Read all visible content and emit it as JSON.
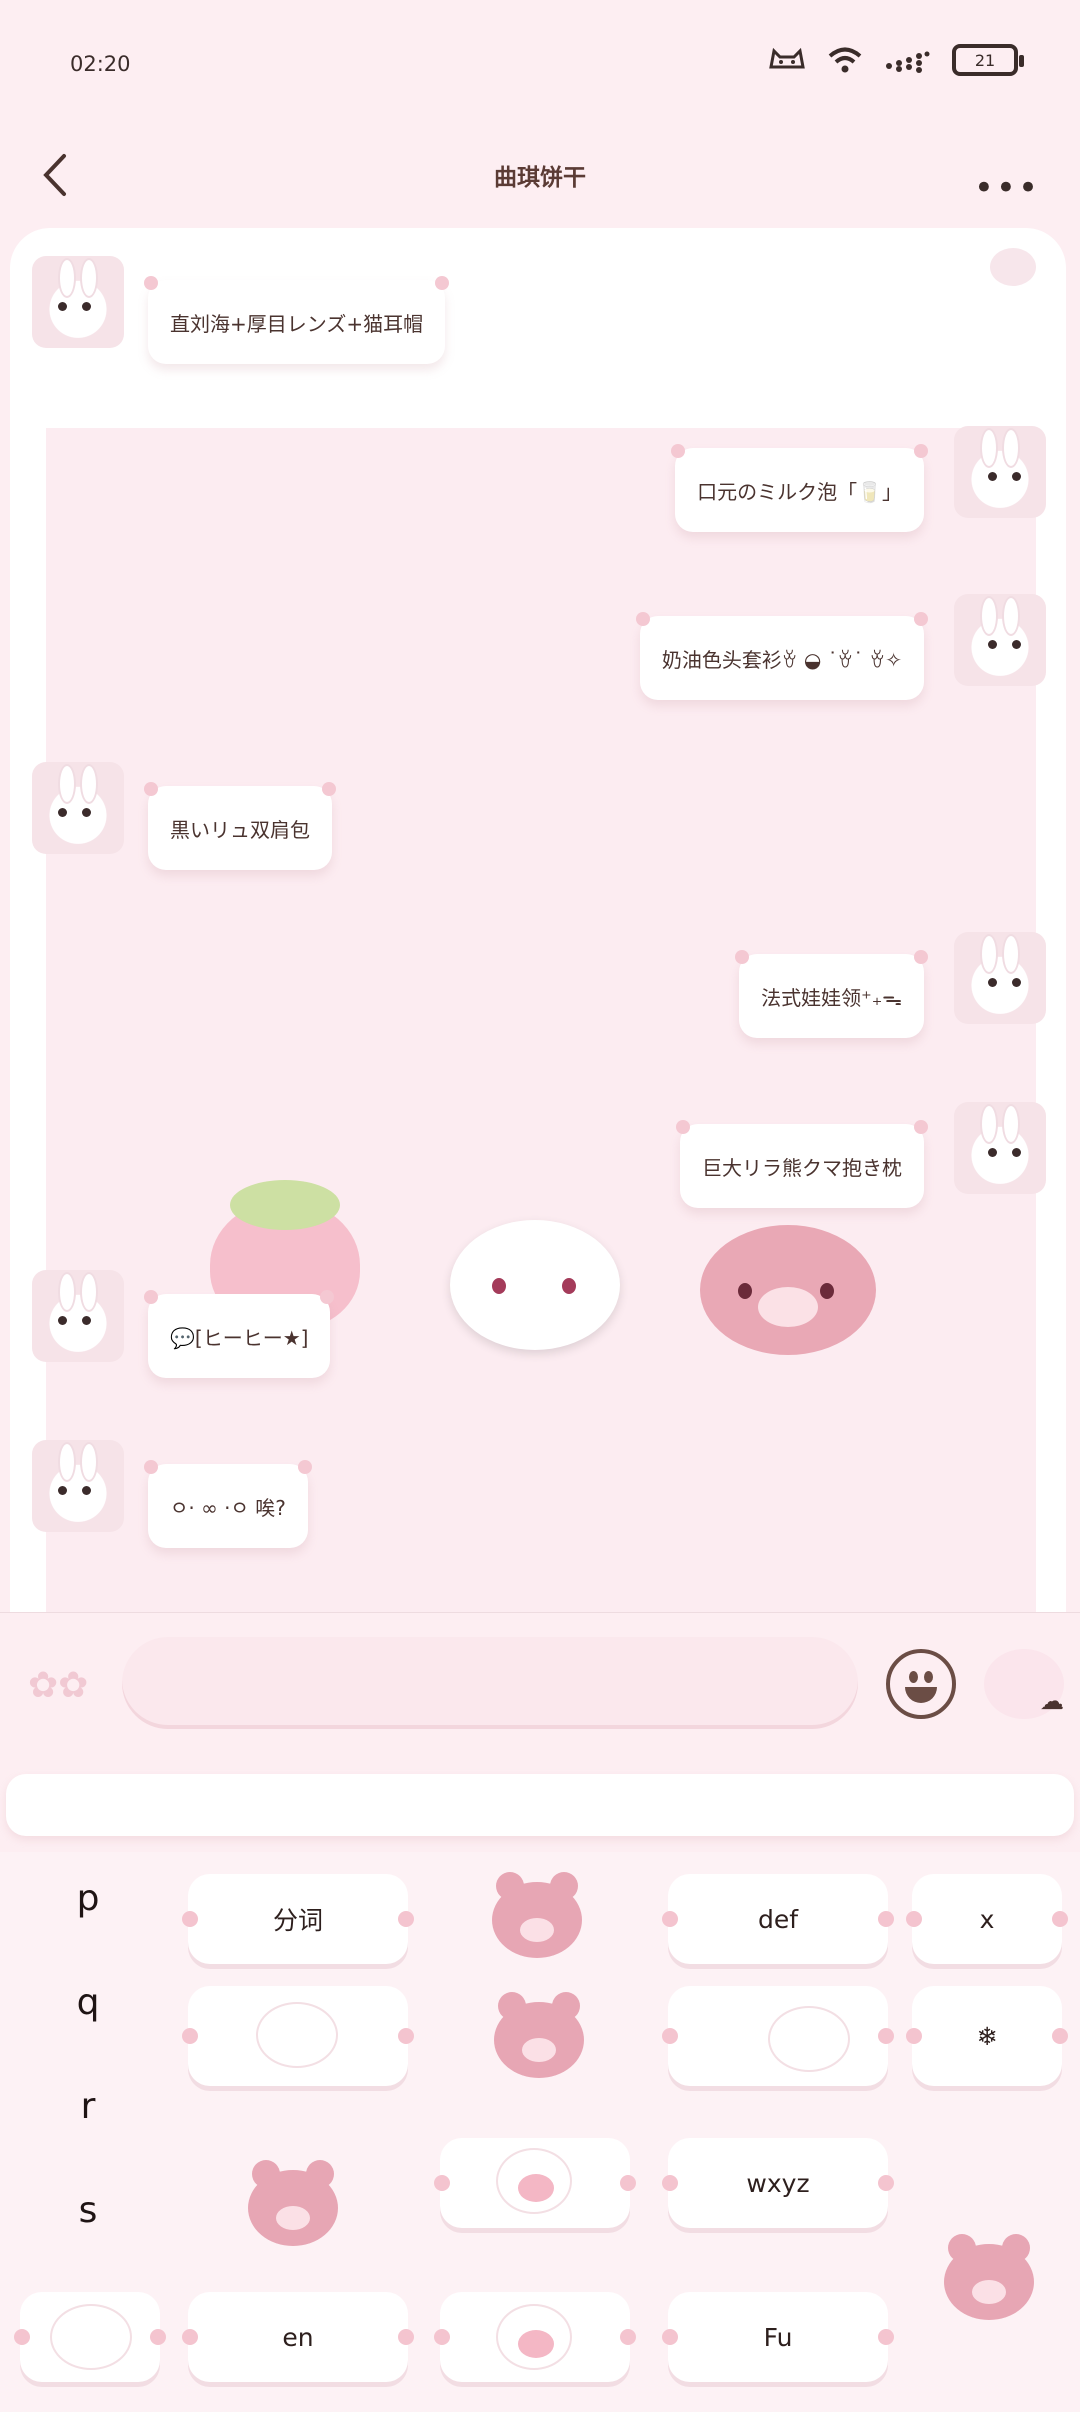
{
  "status_bar": {
    "time": "02:20",
    "battery": "21",
    "icons": [
      "face-icon",
      "wifi-icon",
      "signal-icon",
      "battery-icon"
    ]
  },
  "header": {
    "title": "曲琪饼干",
    "back_icon": "chevron-left-icon",
    "more_icon": "more-icon",
    "more_label": "•••"
  },
  "messages": [
    {
      "side": "left",
      "text": "直刘海+厚目レンズ+猫耳帽"
    },
    {
      "side": "right",
      "text": "口元のミルク泡「🥛」"
    },
    {
      "side": "right",
      "text": "奶油色头套衫ꈊ ◒ ˙ꈊ˙ ꈊ✧"
    },
    {
      "side": "left",
      "text": "黒いリュ双肩包"
    },
    {
      "side": "right",
      "text": "法式娃娃领⁺₊ᯓ"
    },
    {
      "side": "right",
      "text": "巨大リラ熊クマ抱き枕"
    },
    {
      "side": "left",
      "text": "💬[ヒーヒー★]"
    },
    {
      "side": "left",
      "text": "ㅇ· ∞ ·ㅇ 唉?"
    }
  ],
  "input_bar": {
    "placeholder": "",
    "emoji_icon": "emoji-icon",
    "stars_icon": "stars-icon",
    "cloud_icon": "cloud-icon",
    "cloud_glyph": "☁"
  },
  "keyboard": {
    "side_letters": [
      "p",
      "q",
      "r",
      "s"
    ],
    "keys": {
      "segment": "分词",
      "def": "def",
      "delete": "x",
      "snow": "❄",
      "wxyz": "wxyz",
      "en": "en",
      "fu": "Fu"
    }
  },
  "colors": {
    "background": "#fdeef2",
    "bubble": "#ffffff",
    "text": "#4a332f",
    "accent_pink": "#e7a6b4"
  }
}
